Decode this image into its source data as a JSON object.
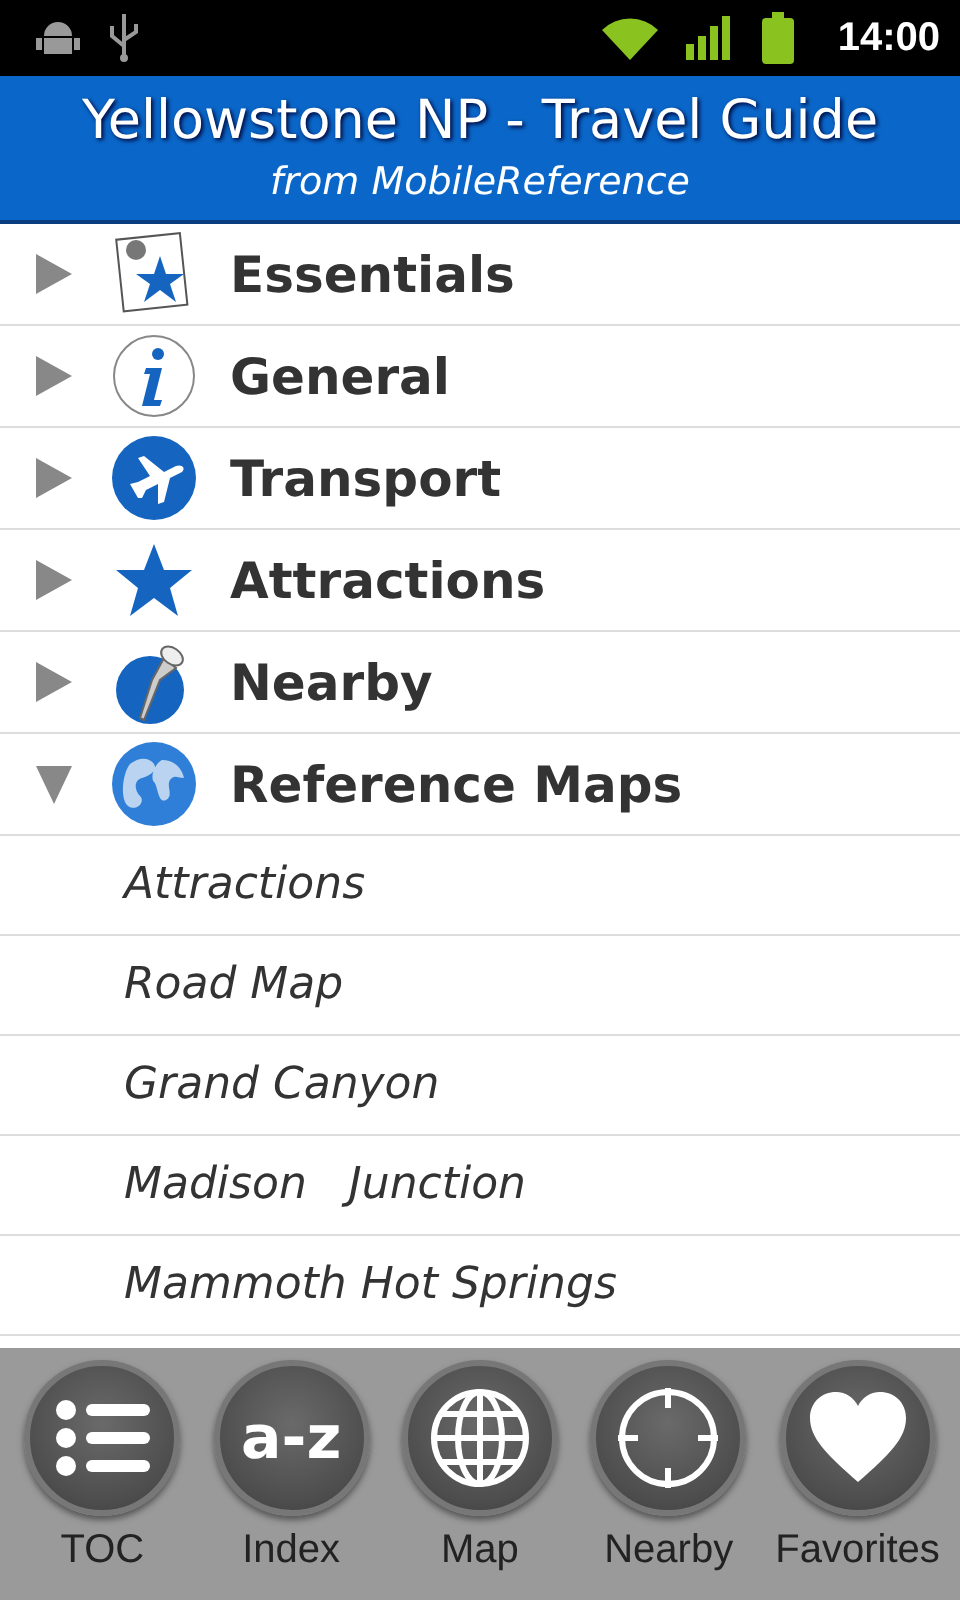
{
  "status_bar": {
    "time": "14:00"
  },
  "header": {
    "title": "Yellowstone NP - Travel Guide",
    "subtitle": "from MobileReference"
  },
  "sections": [
    {
      "label": "Essentials",
      "kind": "essentials",
      "expanded": false
    },
    {
      "label": "General",
      "kind": "info",
      "expanded": false
    },
    {
      "label": "Transport",
      "kind": "plane",
      "expanded": false
    },
    {
      "label": "Attractions",
      "kind": "star",
      "expanded": false
    },
    {
      "label": "Nearby",
      "kind": "pin",
      "expanded": false
    },
    {
      "label": "Reference Maps",
      "kind": "globe",
      "expanded": true,
      "children": [
        {
          "label": "Attractions"
        },
        {
          "label": "Road Map"
        },
        {
          "label": "Grand Canyon"
        },
        {
          "label": "Madison   Junction"
        },
        {
          "label": "Mammoth Hot Springs"
        }
      ]
    }
  ],
  "toolbar": [
    {
      "label": "TOC",
      "kind": "list"
    },
    {
      "label": "Index",
      "kind": "text",
      "glyph": "a-z"
    },
    {
      "label": "Map",
      "kind": "globe"
    },
    {
      "label": "Nearby",
      "kind": "target"
    },
    {
      "label": "Favorites",
      "kind": "heart"
    }
  ]
}
